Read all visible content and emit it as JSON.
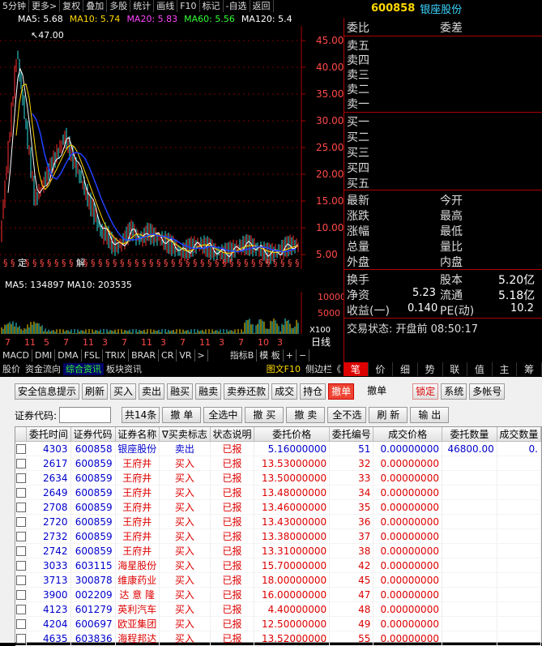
{
  "toolbar": [
    "5分钟",
    "更多>",
    "复权",
    "叠加",
    "多股",
    "统计",
    "画线",
    "F10",
    "标记",
    "-自选",
    "返回"
  ],
  "ma": {
    "ma5": "MA5: 5.68",
    "ma10": "MA10: 5.74",
    "ma20": "MA20: 5.83",
    "ma60": "MA60: 5.56",
    "ma120": "MA120: 5.4"
  },
  "stock": {
    "code": "600858",
    "name": "银座股份"
  },
  "peak_label": "47.00",
  "price_axis": [
    "45.00",
    "40.00",
    "35.00",
    "30.00",
    "25.00",
    "20.00",
    "15.00",
    "10.00",
    "5.00"
  ],
  "vol_legend": "MA5: 134897  MA10: 203535",
  "vol_axis": [
    "10000",
    "5000",
    "X100"
  ],
  "marks": [
    "§",
    "§",
    "定",
    "§",
    "§",
    "§",
    "§",
    "§",
    "§",
    "§",
    "解",
    "§",
    "§",
    "§",
    "§",
    "§",
    "§",
    "§",
    "§",
    "§",
    "§",
    "§",
    "§",
    "§",
    "§",
    "§",
    "§",
    "§",
    "§",
    "§",
    "§",
    "§",
    "§",
    "§",
    "§",
    "§",
    "§",
    "§",
    "§",
    "§",
    "§"
  ],
  "time_axis": [
    "7",
    "11",
    "5",
    "7",
    "11",
    "3",
    "7",
    "11",
    "3",
    "7",
    "11",
    "3",
    "7",
    "10",
    "3"
  ],
  "daily_label": "日线",
  "indicator_tabs": [
    "MACD",
    "DMI",
    "DMA",
    "FSL",
    "TRIX",
    "BRAR",
    "CR",
    "VR",
    ">",
    "指标B",
    "模 板",
    "+",
    "−"
  ],
  "bottom_tabs": [
    "股价",
    "资金流向",
    "综合资讯",
    "板块资讯",
    "图文F10",
    "侧边栏《"
  ],
  "right_tabs": [
    "笔",
    "价",
    "细",
    "势",
    "联",
    "值",
    "主",
    "筹"
  ],
  "quote": {
    "weibi": "委比",
    "weicha": "委差",
    "sell": [
      "卖五",
      "卖四",
      "卖三",
      "卖二",
      "卖一"
    ],
    "buy": [
      "买一",
      "买二",
      "买三",
      "买四",
      "买五"
    ],
    "left": [
      "最新",
      "涨跌",
      "涨幅",
      "总量",
      "外盘"
    ],
    "right": [
      "今开",
      "最高",
      "最低",
      "量比",
      "内盘"
    ],
    "row1": [
      "换手",
      "股本",
      "5.20亿"
    ],
    "row2": [
      "净资",
      "5.23",
      "流通",
      "5.18亿"
    ],
    "row3": [
      "收益(一)",
      "0.140",
      "PE(动)",
      "10.2"
    ],
    "status": "交易状态: 开盘前 08:50:17"
  },
  "trade": {
    "buttons": [
      "安全信息提示",
      "刷新",
      "买入",
      "卖出",
      "融买",
      "融卖",
      "卖券还款",
      "成交",
      "持仓",
      "撤单",
      "撤单",
      "锁定",
      "系统",
      "多帐号"
    ],
    "code_label": "证券代码:",
    "count": "共14条",
    "row2_buttons": [
      "撤 单",
      "全选中",
      "撤 买",
      "撤 卖",
      "全不选",
      "刷 新",
      "输 出"
    ],
    "headers": [
      "委托时间",
      "证券代码",
      "证券名称",
      "∇买卖标志",
      "状态说明",
      "委托价格",
      "委托编号",
      "成交价格",
      "委托数量",
      "成交数量"
    ],
    "rows": [
      [
        "4303",
        "600858",
        "银座股份",
        "卖出",
        "已报",
        "5.16000000",
        "51",
        "0.00000000",
        "46800.00",
        "0."
      ],
      [
        "2617",
        "600859",
        "王府井",
        "买入",
        "已报",
        "13.53000000",
        "32",
        "0.00000000",
        "",
        ""
      ],
      [
        "2634",
        "600859",
        "王府井",
        "买入",
        "已报",
        "13.50000000",
        "33",
        "0.00000000",
        "",
        ""
      ],
      [
        "2649",
        "600859",
        "王府井",
        "买入",
        "已报",
        "13.48000000",
        "34",
        "0.00000000",
        "",
        ""
      ],
      [
        "2708",
        "600859",
        "王府井",
        "买入",
        "已报",
        "13.46000000",
        "35",
        "0.00000000",
        "",
        ""
      ],
      [
        "2720",
        "600859",
        "王府井",
        "买入",
        "已报",
        "13.43000000",
        "36",
        "0.00000000",
        "",
        ""
      ],
      [
        "2732",
        "600859",
        "王府井",
        "买入",
        "已报",
        "13.38000000",
        "37",
        "0.00000000",
        "",
        ""
      ],
      [
        "2742",
        "600859",
        "王府井",
        "买入",
        "已报",
        "13.31000000",
        "38",
        "0.00000000",
        "",
        ""
      ],
      [
        "3033",
        "603115",
        "海星股份",
        "买入",
        "已报",
        "15.70000000",
        "42",
        "0.00000000",
        "",
        ""
      ],
      [
        "3713",
        "300878",
        "维康药业",
        "买入",
        "已报",
        "18.00000000",
        "45",
        "0.00000000",
        "",
        ""
      ],
      [
        "3900",
        "002209",
        "达 意 隆",
        "买入",
        "已报",
        "16.00000000",
        "47",
        "0.00000000",
        "",
        ""
      ],
      [
        "4123",
        "601279",
        "英利汽车",
        "买入",
        "已报",
        "4.40000000",
        "48",
        "0.00000000",
        "",
        ""
      ],
      [
        "4204",
        "600697",
        "欧亚集团",
        "买入",
        "已报",
        "12.50000000",
        "49",
        "0.00000000",
        "",
        ""
      ],
      [
        "4635",
        "603836",
        "海程邦达",
        "买入",
        "已报",
        "13.52000000",
        "55",
        "0.00000000",
        "",
        ""
      ]
    ]
  },
  "colors": {
    "ma5": "#ffffff",
    "ma10": "#ffd800",
    "ma20": "#ff00ff",
    "ma60": "#00ff00",
    "ma120": "#ffffff",
    "up": "#ff3030",
    "down": "#30e0e0"
  }
}
